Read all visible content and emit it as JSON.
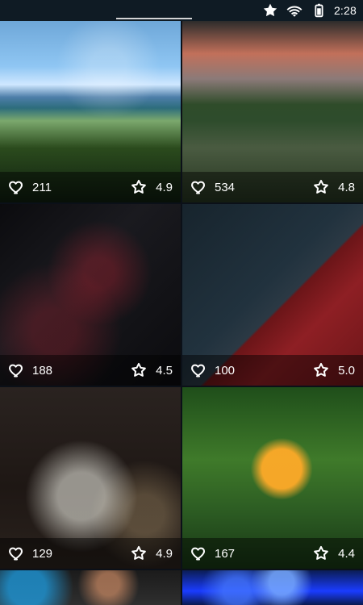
{
  "status_bar": {
    "time": "2:28",
    "icons": [
      "star-icon",
      "wifi-icon",
      "battery-icon"
    ]
  },
  "grid": {
    "tiles": [
      {
        "likes": "211",
        "rating": "4.9"
      },
      {
        "likes": "534",
        "rating": "4.8"
      },
      {
        "likes": "188",
        "rating": "4.5"
      },
      {
        "likes": "100",
        "rating": "5.0"
      },
      {
        "likes": "129",
        "rating": "4.9"
      },
      {
        "likes": "167",
        "rating": "4.4"
      },
      {
        "likes": "",
        "rating": ""
      },
      {
        "likes": "",
        "rating": ""
      }
    ]
  },
  "colors": {
    "status_bar_bg": "#0f1b24",
    "overlay_bg": "rgba(0,0,0,0.45)",
    "text": "#ffffff"
  }
}
